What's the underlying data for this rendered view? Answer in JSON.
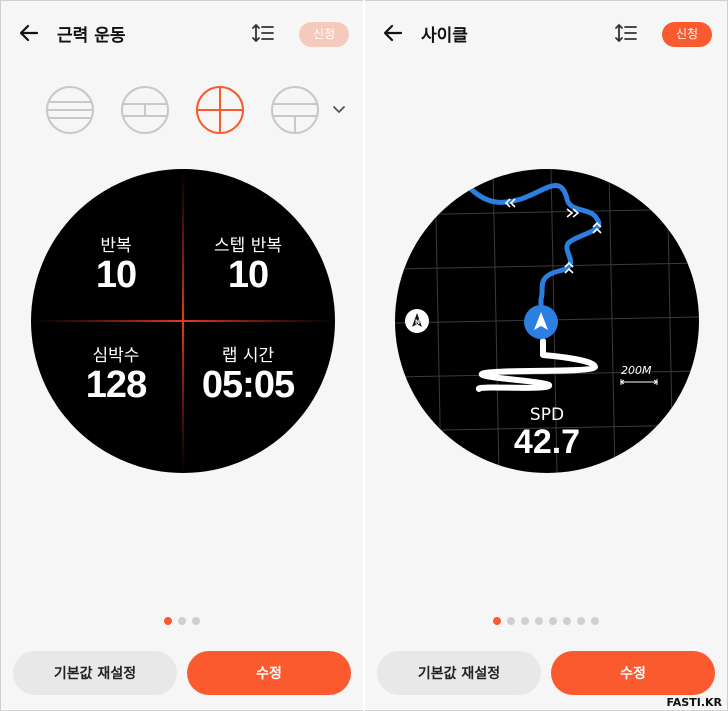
{
  "left": {
    "title": "근력 운동",
    "apply_label": "신청",
    "fields": [
      {
        "label": "반복",
        "value": "10"
      },
      {
        "label": "스텝 반복",
        "value": "10"
      },
      {
        "label": "심박수",
        "value": "128"
      },
      {
        "label": "랩 시간",
        "value": "05:05"
      }
    ],
    "page_dots": 3,
    "active_dot": 0,
    "reset_label": "기본값 재설정",
    "edit_label": "수정"
  },
  "right": {
    "title": "사이클",
    "apply_label": "신청",
    "scale_label": "200M",
    "speed_label": "SPD",
    "speed_value": "42.7",
    "page_dots": 8,
    "active_dot": 0,
    "reset_label": "기본값 재설정",
    "edit_label": "수정"
  },
  "brand": "FASTI.KR",
  "colors": {
    "accent": "#fb5a2f",
    "accent_disabled": "#f6c9bd",
    "route": "#2a7fe0",
    "watch_bg": "#000000"
  }
}
